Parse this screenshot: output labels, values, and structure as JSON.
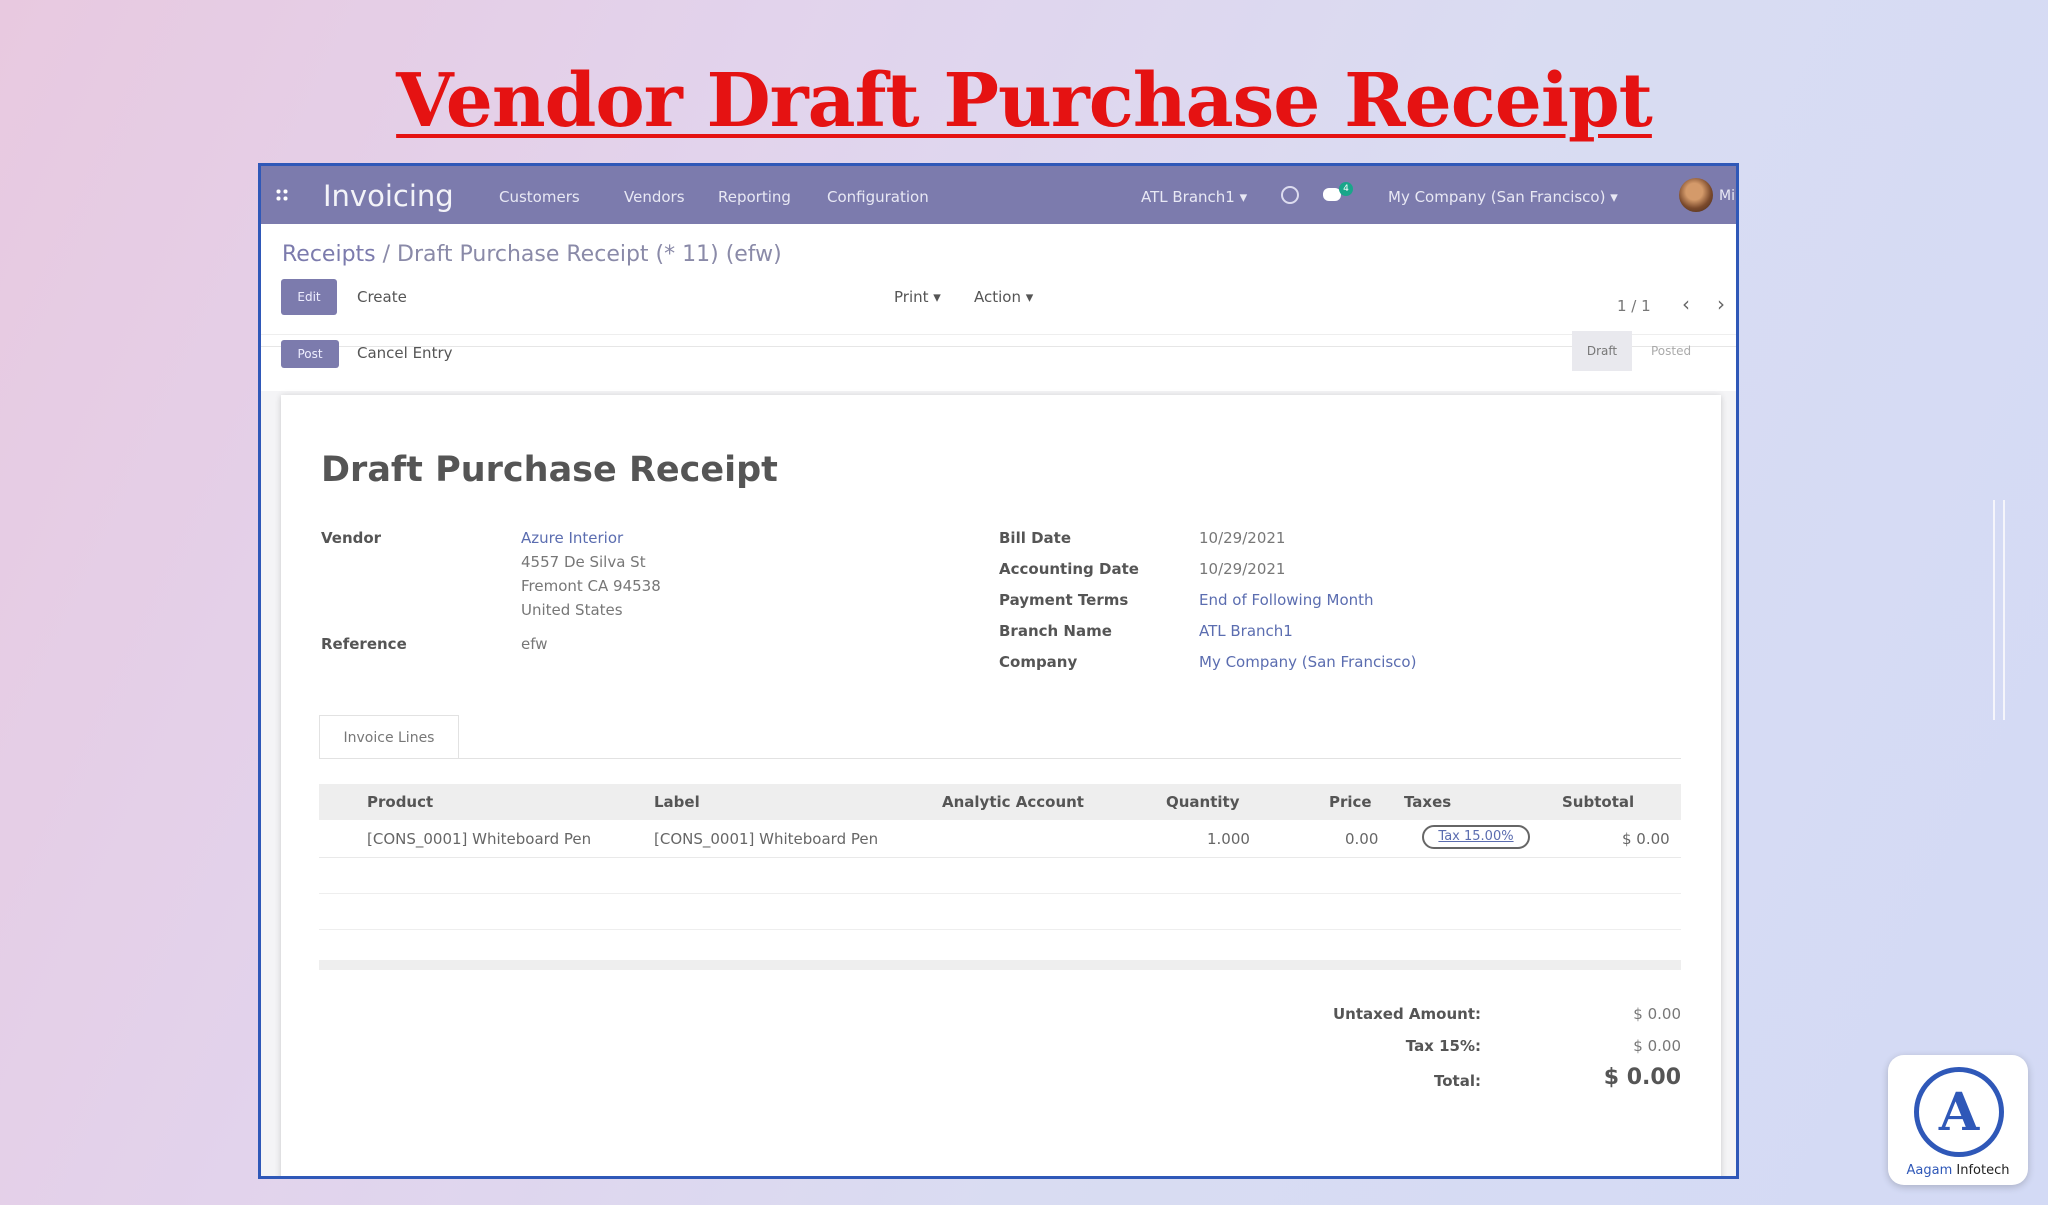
{
  "slide": {
    "title": "Vendor Draft Purchase Receipt"
  },
  "navbar": {
    "app_name": "Invoicing",
    "menu": [
      "Customers",
      "Vendors",
      "Reporting",
      "Configuration"
    ],
    "branch": "ATL Branch1 ▾",
    "chat_badge": "4",
    "company": "My Company (San Francisco) ▾",
    "user": "Mi"
  },
  "breadcrumb": {
    "parent": "Receipts",
    "separator": " / ",
    "current": "Draft Purchase Receipt (* 11) (efw)"
  },
  "toolbar": {
    "edit": "Edit",
    "create": "Create",
    "print": "Print ▾",
    "action": "Action ▾",
    "pager": "1 / 1",
    "prev": "‹",
    "next": "›",
    "post": "Post",
    "cancel_entry": "Cancel Entry",
    "status_draft": "Draft",
    "status_posted": "Posted"
  },
  "form": {
    "title": "Draft Purchase Receipt",
    "vendor_label": "Vendor",
    "vendor_name": "Azure Interior",
    "vendor_addr1": "4557 De Silva St",
    "vendor_addr2": "Fremont CA 94538",
    "vendor_addr3": "United States",
    "reference_label": "Reference",
    "reference_value": "efw",
    "bill_date_label": "Bill Date",
    "bill_date": "10/29/2021",
    "accounting_date_label": "Accounting Date",
    "accounting_date": "10/29/2021",
    "payment_terms_label": "Payment Terms",
    "payment_terms": "End of Following Month",
    "branch_label": "Branch Name",
    "branch": "ATL Branch1",
    "company_label": "Company",
    "company": "My Company (San Francisco)"
  },
  "tabs": {
    "invoice_lines": "Invoice Lines"
  },
  "table": {
    "headers": [
      "Product",
      "Label",
      "Analytic Account",
      "Quantity",
      "Price",
      "Taxes",
      "Subtotal"
    ],
    "rows": [
      {
        "product": "[CONS_0001] Whiteboard Pen",
        "label": "[CONS_0001] Whiteboard Pen",
        "analytic": "",
        "quantity": "1.000",
        "price": "0.00",
        "taxes": "Tax 15.00%",
        "subtotal": "$ 0.00"
      }
    ]
  },
  "totals": {
    "untaxed_label": "Untaxed Amount:",
    "untaxed": "$ 0.00",
    "tax_label": "Tax 15%:",
    "tax": "$ 0.00",
    "total_label": "Total:",
    "total": "$ 0.00"
  },
  "logo": {
    "letter": "A",
    "name_a": "Aagam",
    "name_b": " Infotech"
  },
  "colors": {
    "title_red": "#e51212",
    "frame_blue": "#2f58b8",
    "navbar": "#7c7bad"
  }
}
